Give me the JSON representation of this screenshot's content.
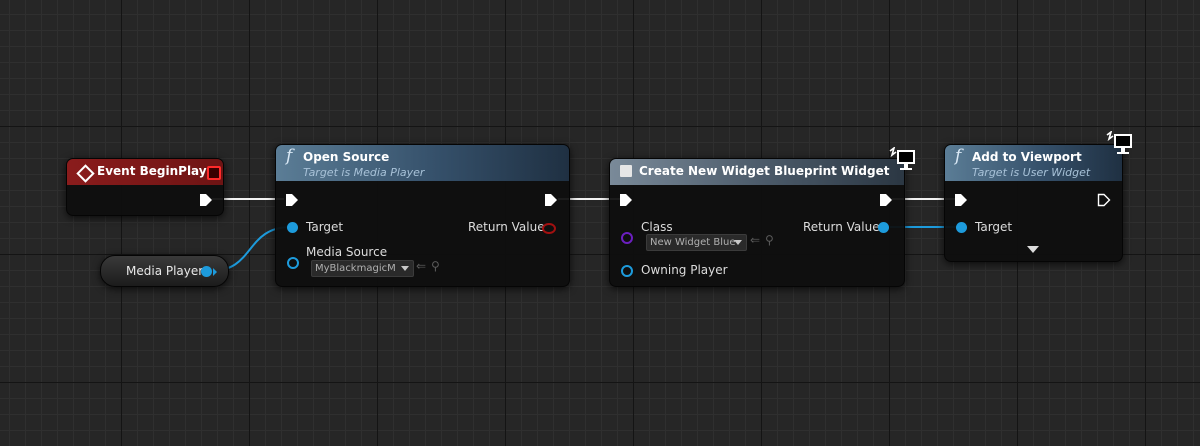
{
  "graph": {
    "event_node": {
      "title": "Event BeginPlay"
    },
    "variable_node": {
      "label": "Media Player"
    },
    "open_source": {
      "title": "Open Source",
      "subtitle": "Target is Media Player",
      "pin_target": "Target",
      "pin_return": "Return Value",
      "pin_media_source": "Media Source",
      "media_source_value": "MyBlackmagicM"
    },
    "create_widget": {
      "title": "Create New Widget Blueprint Widget",
      "pin_class": "Class",
      "class_value": "New Widget Blue",
      "pin_return": "Return Value",
      "pin_owning_player": "Owning Player"
    },
    "add_to_viewport": {
      "title": "Add to Viewport",
      "subtitle": "Target is User Widget",
      "pin_target": "Target"
    }
  },
  "icons": {
    "function": "function-icon",
    "event": "event-diamond-icon",
    "widget": "widget-icon",
    "monitor": "client-monitor-icon",
    "expand": "expand-arrow-icon"
  },
  "colors": {
    "exec_wire": "#ffffff",
    "object_wire": "#1d9bdc",
    "class_pin": "#6b1fbf",
    "event_header": "#8a1c1c",
    "function_header": "#35506a"
  },
  "function_glyph": "f"
}
